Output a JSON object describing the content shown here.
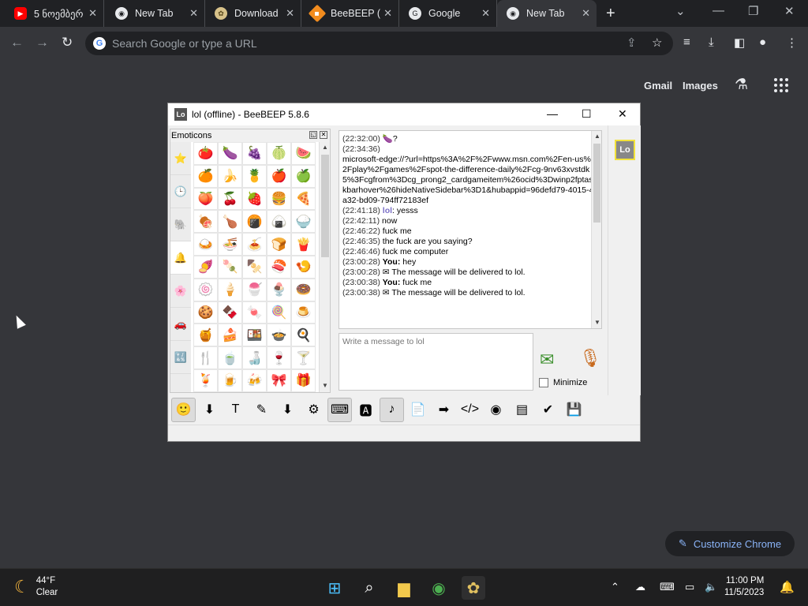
{
  "tabs": [
    {
      "title": "5 ნოემბერ",
      "icon": "youtube-icon"
    },
    {
      "title": "New Tab",
      "icon": "chrome-icon"
    },
    {
      "title": "Download",
      "icon": "beebeep-icon"
    },
    {
      "title": "BeeBEEP (",
      "icon": "beebeep-icon"
    },
    {
      "title": "Google",
      "icon": "google-icon"
    },
    {
      "title": "New Tab",
      "icon": "chrome-icon"
    }
  ],
  "omnibox": {
    "placeholder": "Search Google or type a URL"
  },
  "google_links": {
    "gmail": "Gmail",
    "images": "Images"
  },
  "beebeep": {
    "title": "lol (offline) - BeeBEEP 5.8.6",
    "avatar_text": "Lo",
    "emoticons_label": "Emoticons",
    "input_placeholder": "Write a message to lol",
    "minimize_label": "Minimize",
    "chat": [
      {
        "time": "(22:32:00)",
        "text": "🍆?"
      },
      {
        "time": "(22:34:36)",
        "text": "microsoft-edge://?url=https%3A%2F%2Fwww.msn.com%2Fen-us%2Fplay%2Fgames%2Fspot-the-difference-daily%2Fcg-9nv63xvstdk5%3Fcgfrom%3Dcg_prong2_cardgameitem%26ocid%3Dwinp2fptaskbarhover%26hideNativeSidebar%3D1&hubappid=96defd79-4015-4a32-bd09-794ff72183ef"
      },
      {
        "time": "(22:41:18)",
        "nick": "lol",
        "text": ": yesss"
      },
      {
        "time": "(22:42:11)",
        "text": "now"
      },
      {
        "time": "(22:46:22)",
        "text": "fuck me"
      },
      {
        "time": "(22:46:35)",
        "text": "the fuck are you saying?"
      },
      {
        "time": "(22:46:46)",
        "text": "fuck me computer"
      },
      {
        "time": "(23:00:28)",
        "you": "You:",
        "text": "hey"
      },
      {
        "time": "(23:00:28)",
        "text": "✉ The message will be delivered to lol."
      },
      {
        "time": "(23:00:38)",
        "you": "You:",
        "text": "fuck me"
      },
      {
        "time": "(23:00:38)",
        "text": "✉ The message will be delivered to lol."
      }
    ],
    "emoji_categories": [
      "⭐",
      "🕒",
      "🐘",
      "🔔",
      "🌸",
      "🚗",
      "🔣"
    ],
    "emoji_grid": [
      "🍅",
      "🍆",
      "🍇",
      "🍈",
      "🍉",
      "🍊",
      "🍌",
      "🍍",
      "🍎",
      "🍏",
      "🍑",
      "🍒",
      "🍓",
      "🍔",
      "🍕",
      "🍖",
      "🍗",
      "🍘",
      "🍙",
      "🍚",
      "🍛",
      "🍜",
      "🍝",
      "🍞",
      "🍟",
      "🍠",
      "🍡",
      "🍢",
      "🍣",
      "🍤",
      "🍥",
      "🍦",
      "🍧",
      "🍨",
      "🍩",
      "🍪",
      "🍫",
      "🍬",
      "🍭",
      "🍮",
      "🍯",
      "🍰",
      "🍱",
      "🍲",
      "🍳",
      "🍴",
      "🍵",
      "🍶",
      "🍷",
      "🍸",
      "🍹",
      "🍺",
      "🍻",
      "🎀",
      "🎁"
    ],
    "toolbar": [
      "🙂",
      "⬇",
      "T",
      "✎",
      "⬇",
      "⚙",
      "⌨",
      "🅰",
      "♪",
      "📄",
      "➡",
      "</>",
      "◉",
      "▤",
      "✔",
      "💾"
    ]
  },
  "customize_chrome": "Customize Chrome",
  "taskbar": {
    "temp": "44°F",
    "condition": "Clear",
    "time": "11:00 PM",
    "date": "11/5/2023"
  },
  "colors": {
    "chrome_bg": "#35363a",
    "tabstrip": "#202124",
    "link_blue": "#8ab4f8",
    "avatar_border": "#f2e23a"
  }
}
